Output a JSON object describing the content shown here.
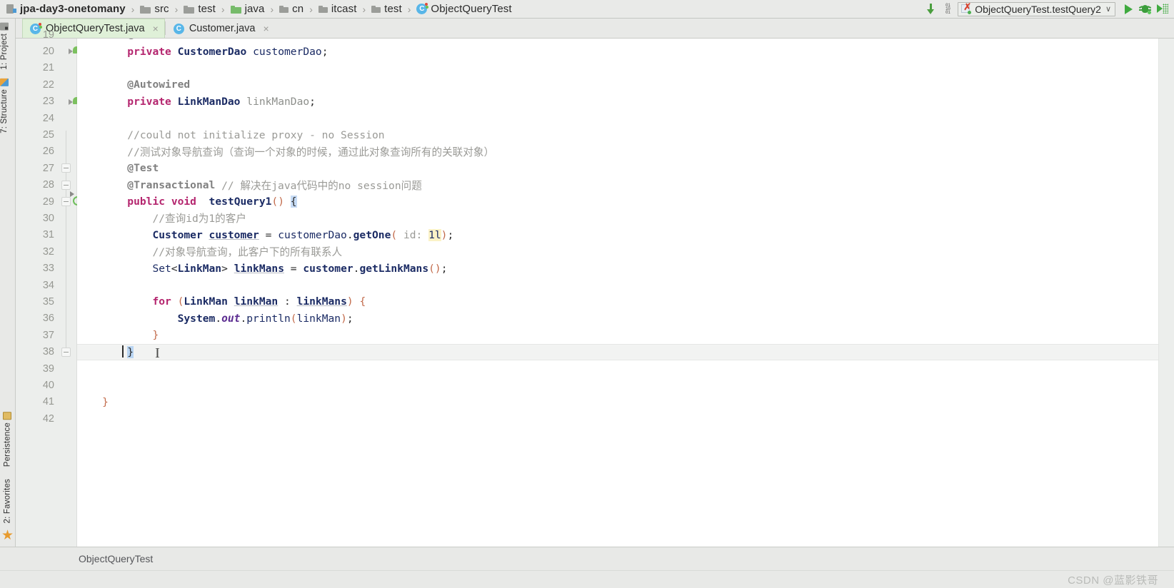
{
  "window": {
    "breadcrumb": [
      {
        "label": "jpa-day3-onetomany",
        "icon": "module-icon",
        "bold": true
      },
      {
        "label": "src",
        "icon": "folder-icon",
        "bold": false
      },
      {
        "label": "test",
        "icon": "folder-icon",
        "bold": false
      },
      {
        "label": "java",
        "icon": "folder-green-icon",
        "bold": false
      },
      {
        "label": "cn",
        "icon": "folder-small-icon",
        "bold": false
      },
      {
        "label": "itcast",
        "icon": "folder-small-icon",
        "bold": false
      },
      {
        "label": "test",
        "icon": "folder-small-icon",
        "bold": false
      },
      {
        "label": "ObjectQueryTest",
        "icon": "java-class-icon",
        "bold": false
      }
    ],
    "separator": "›"
  },
  "toolbar": {
    "download_icon": "download-arrow-icon",
    "binary_icon": "binary-icon",
    "run_configuration": "ObjectQueryTest.testQuery2",
    "run_config_caret": "∨",
    "run_button": "run-icon",
    "debug_button": "debug-icon",
    "coverage_button": "run-with-coverage-icon"
  },
  "file_tabs": [
    {
      "label": "ObjectQueryTest.java",
      "icon": "java-test-class-icon",
      "active": true,
      "close": "×"
    },
    {
      "label": "Customer.java",
      "icon": "java-class-icon",
      "active": false,
      "close": "×"
    }
  ],
  "left_tool_window": {
    "top_items": [
      {
        "label": "1: Project",
        "icon": "project-icon"
      },
      {
        "label": "7: Structure",
        "icon": "structure-icon"
      }
    ],
    "bottom_items": [
      {
        "label": "Persistence",
        "icon": "persistence-icon"
      },
      {
        "label": "2: Favorites",
        "icon": "favorites-star-icon"
      }
    ],
    "bottom_star": "★"
  },
  "editor": {
    "caret_line": 38,
    "first_line": 19,
    "lines": [
      {
        "n": 19,
        "marker": "",
        "tokens": [
          {
            "t": "        ",
            "c": "plain"
          },
          {
            "t": "@Autowired",
            "c": "ann"
          }
        ]
      },
      {
        "n": 20,
        "marker": "bean",
        "tokens": [
          {
            "t": "        ",
            "c": "plain"
          },
          {
            "t": "private",
            "c": "kw"
          },
          {
            "t": " ",
            "c": "plain"
          },
          {
            "t": "CustomerDao",
            "c": "type"
          },
          {
            "t": " ",
            "c": "plain"
          },
          {
            "t": "customerDao",
            "c": "ident"
          },
          {
            "t": ";",
            "c": "plain"
          }
        ]
      },
      {
        "n": 21,
        "marker": "",
        "tokens": []
      },
      {
        "n": 22,
        "marker": "",
        "tokens": [
          {
            "t": "        ",
            "c": "plain"
          },
          {
            "t": "@Autowired",
            "c": "ann"
          }
        ]
      },
      {
        "n": 23,
        "marker": "bean",
        "tokens": [
          {
            "t": "        ",
            "c": "plain"
          },
          {
            "t": "private",
            "c": "kw"
          },
          {
            "t": " ",
            "c": "plain"
          },
          {
            "t": "LinkManDao",
            "c": "type"
          },
          {
            "t": " ",
            "c": "plain"
          },
          {
            "t": "linkManDao",
            "c": "graytxt"
          },
          {
            "t": ";",
            "c": "plain"
          }
        ]
      },
      {
        "n": 24,
        "marker": "",
        "tokens": []
      },
      {
        "n": 25,
        "marker": "",
        "tokens": [
          {
            "t": "        ",
            "c": "plain"
          },
          {
            "t": "//could not initialize proxy - no Session",
            "c": "cmt"
          }
        ]
      },
      {
        "n": 26,
        "marker": "",
        "tokens": [
          {
            "t": "        ",
            "c": "plain"
          },
          {
            "t": "//测试对象导航查询（查询一个对象的时候，通过此对象查询所有的关联对象）",
            "c": "cmt"
          }
        ]
      },
      {
        "n": 27,
        "marker": "",
        "tokens": [
          {
            "t": "        ",
            "c": "plain"
          },
          {
            "t": "@Test",
            "c": "ann"
          }
        ]
      },
      {
        "n": 28,
        "marker": "",
        "tokens": [
          {
            "t": "        ",
            "c": "plain"
          },
          {
            "t": "@Transactional",
            "c": "ann"
          },
          {
            "t": " ",
            "c": "plain"
          },
          {
            "t": "// 解决在java代码中的no session问题",
            "c": "cmt"
          }
        ]
      },
      {
        "n": 29,
        "marker": "run",
        "tokens": [
          {
            "t": "        ",
            "c": "plain"
          },
          {
            "t": "public",
            "c": "kw"
          },
          {
            "t": " ",
            "c": "plain"
          },
          {
            "t": "void",
            "c": "kw"
          },
          {
            "t": "  ",
            "c": "plain"
          },
          {
            "t": "testQuery1",
            "c": "meth"
          },
          {
            "t": "()",
            "c": "paren"
          },
          {
            "t": " ",
            "c": "plain"
          },
          {
            "t": "{",
            "c": "selbrace"
          }
        ]
      },
      {
        "n": 30,
        "marker": "",
        "tokens": [
          {
            "t": "            ",
            "c": "plain"
          },
          {
            "t": "//查询id为1的客户",
            "c": "cmt"
          }
        ]
      },
      {
        "n": 31,
        "marker": "",
        "tokens": [
          {
            "t": "            ",
            "c": "plain"
          },
          {
            "t": "Customer",
            "c": "type"
          },
          {
            "t": " ",
            "c": "plain"
          },
          {
            "t": "customer",
            "c": "localv"
          },
          {
            "t": " = ",
            "c": "plain"
          },
          {
            "t": "customerDao",
            "c": "ident"
          },
          {
            "t": ".",
            "c": "plain"
          },
          {
            "t": "getOne",
            "c": "meth"
          },
          {
            "t": "(",
            "c": "paren"
          },
          {
            "t": " id: ",
            "c": "hint"
          },
          {
            "t": "1l",
            "c": "num"
          },
          {
            "t": ")",
            "c": "paren"
          },
          {
            "t": ";",
            "c": "plain"
          }
        ]
      },
      {
        "n": 32,
        "marker": "",
        "tokens": [
          {
            "t": "            ",
            "c": "plain"
          },
          {
            "t": "//对象导航查询，此客户下的所有联系人",
            "c": "cmt"
          }
        ]
      },
      {
        "n": 33,
        "marker": "",
        "tokens": [
          {
            "t": "            ",
            "c": "plain"
          },
          {
            "t": "Set",
            "c": "ident"
          },
          {
            "t": "<",
            "c": "plain"
          },
          {
            "t": "LinkMan",
            "c": "type"
          },
          {
            "t": ">",
            "c": "plain"
          },
          {
            "t": " ",
            "c": "plain"
          },
          {
            "t": "linkMans",
            "c": "localv"
          },
          {
            "t": " = ",
            "c": "plain"
          },
          {
            "t": "customer",
            "c": "meth"
          },
          {
            "t": ".",
            "c": "plain"
          },
          {
            "t": "getLinkMans",
            "c": "meth"
          },
          {
            "t": "()",
            "c": "paren"
          },
          {
            "t": ";",
            "c": "plain"
          }
        ]
      },
      {
        "n": 34,
        "marker": "",
        "tokens": []
      },
      {
        "n": 35,
        "marker": "",
        "tokens": [
          {
            "t": "            ",
            "c": "plain"
          },
          {
            "t": "for",
            "c": "kw"
          },
          {
            "t": " ",
            "c": "plain"
          },
          {
            "t": "(",
            "c": "paren"
          },
          {
            "t": "LinkMan",
            "c": "type"
          },
          {
            "t": " ",
            "c": "plain"
          },
          {
            "t": "linkMan",
            "c": "localv"
          },
          {
            "t": " : ",
            "c": "plain"
          },
          {
            "t": "linkMans",
            "c": "localv"
          },
          {
            "t": ")",
            "c": "paren"
          },
          {
            "t": " ",
            "c": "plain"
          },
          {
            "t": "{",
            "c": "brace"
          }
        ]
      },
      {
        "n": 36,
        "marker": "",
        "tokens": [
          {
            "t": "                ",
            "c": "plain"
          },
          {
            "t": "System",
            "c": "meth"
          },
          {
            "t": ".",
            "c": "plain"
          },
          {
            "t": "out",
            "c": "methi"
          },
          {
            "t": ".",
            "c": "plain"
          },
          {
            "t": "println",
            "c": "ident"
          },
          {
            "t": "(",
            "c": "paren"
          },
          {
            "t": "linkMan",
            "c": "ident"
          },
          {
            "t": ")",
            "c": "paren"
          },
          {
            "t": ";",
            "c": "plain"
          }
        ]
      },
      {
        "n": 37,
        "marker": "",
        "tokens": [
          {
            "t": "            ",
            "c": "plain"
          },
          {
            "t": "}",
            "c": "brace"
          }
        ]
      },
      {
        "n": 38,
        "marker": "",
        "tokens": [
          {
            "t": "        ",
            "c": "plain"
          },
          {
            "t": "}",
            "c": "curbrace"
          }
        ]
      },
      {
        "n": 39,
        "marker": "",
        "tokens": []
      },
      {
        "n": 40,
        "marker": "",
        "tokens": []
      },
      {
        "n": 41,
        "marker": "",
        "tokens": [
          {
            "t": "    ",
            "c": "plain"
          },
          {
            "t": "}",
            "c": "brace"
          }
        ]
      },
      {
        "n": 42,
        "marker": "",
        "tokens": []
      }
    ]
  },
  "status_bar": {
    "breadcrumb_label": "ObjectQueryTest",
    "watermark": "CSDN @蓝影铁哥"
  },
  "colors": {
    "tab_active_bg": "#dff0d8",
    "keyword": "#b4256e",
    "comment": "#9a9a96",
    "type": "#1b2b64",
    "number_highlight": "#fbf2c7",
    "accent_green": "#4a9e3e"
  }
}
